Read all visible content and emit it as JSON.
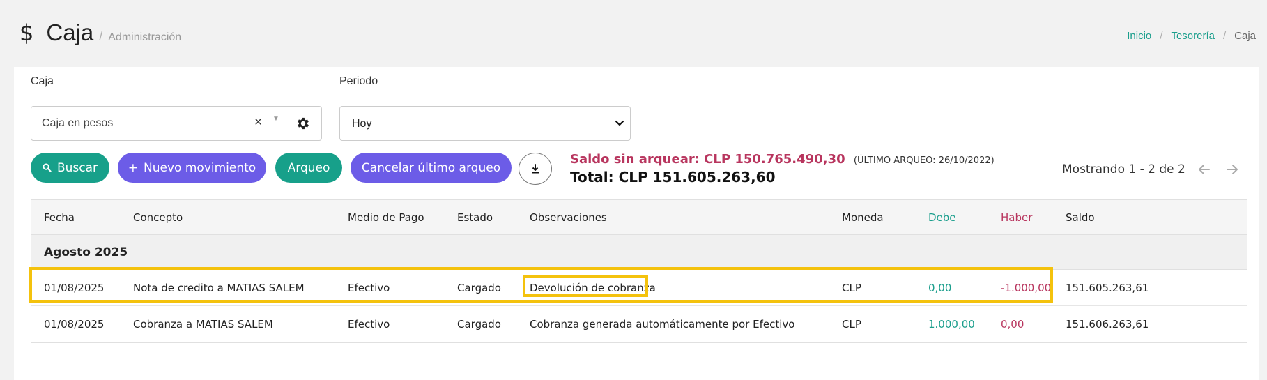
{
  "header": {
    "icon": "dollar-icon",
    "icon_glyph": "$",
    "title": "Caja",
    "title_separator": "/",
    "subtitle": "Administración",
    "breadcrumb": [
      {
        "label": "Inicio",
        "link": true
      },
      {
        "label": "Tesorería",
        "link": true
      },
      {
        "label": "Caja",
        "link": false
      }
    ],
    "breadcrumb_separator": "/"
  },
  "filters": {
    "caja_label": "Caja",
    "caja_value": "Caja en pesos",
    "caja_clear_glyph": "×",
    "caja_arrow_glyph": "▼",
    "periodo_label": "Periodo",
    "periodo_value": "Hoy"
  },
  "actions": {
    "buscar": "Buscar",
    "nuevo_movimiento_glyph": "+",
    "nuevo_movimiento": "Nuevo movimiento",
    "arqueo": "Arqueo",
    "cancelar_ultimo_arqueo": "Cancelar último arqueo"
  },
  "summary": {
    "saldo_sin_arquear": "Saldo sin arquear: CLP 150.765.490,30",
    "ultimo_arqueo": "(ÚLTIMO ARQUEO: 26/10/2022)",
    "total": "Total: CLP 151.605.263,60"
  },
  "pagination": {
    "text": "Mostrando 1 - 2 de 2"
  },
  "table": {
    "columns": [
      "Fecha",
      "Concepto",
      "Medio de Pago",
      "Estado",
      "Observaciones",
      "Moneda",
      "Debe",
      "Haber",
      "Saldo"
    ],
    "group": "Agosto 2025",
    "rows": [
      {
        "fecha": "01/08/2025",
        "concepto": "Nota de credito a MATIAS SALEM",
        "medio": "Efectivo",
        "estado": "Cargado",
        "observaciones": "Devolución de cobranza",
        "moneda": "CLP",
        "debe": "0,00",
        "haber": "-1.000,00",
        "saldo": "151.605.263,61"
      },
      {
        "fecha": "01/08/2025",
        "concepto": "Cobranza a MATIAS SALEM",
        "medio": "Efectivo",
        "estado": "Cargado",
        "observaciones": "Cobranza generada automáticamente por Efectivo",
        "moneda": "CLP",
        "debe": "1.000,00",
        "haber": "0,00",
        "saldo": "151.606.263,61"
      }
    ]
  },
  "colors": {
    "teal": "#17a08a",
    "purple": "#6c5ce7",
    "crimson": "#b8355e",
    "highlight": "#f4c20d"
  }
}
